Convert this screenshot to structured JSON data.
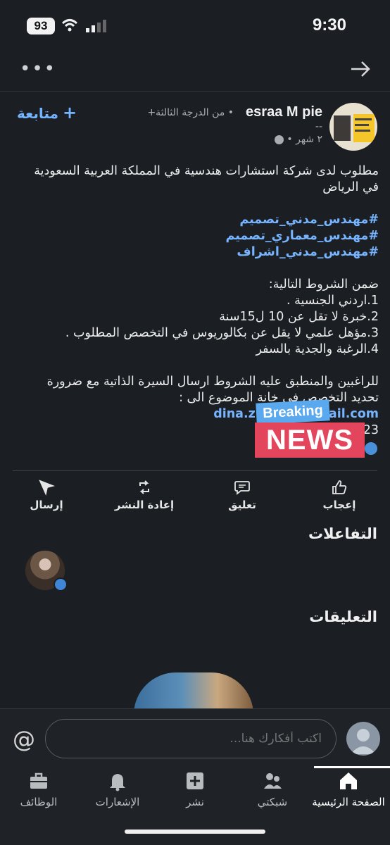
{
  "status": {
    "time": "9:30",
    "battery": "93"
  },
  "post": {
    "author_name": "esraa M pie",
    "degree": "• من الدرجة الثالثة+",
    "subtitle": "--",
    "time_ago": "٢ شهر •",
    "follow_label": "متابعة",
    "body": {
      "intro_1": "مطلوب لدى شركة استشارات هندسية في المملكة العربية السعودية",
      "intro_2": "في الرياض",
      "hashtags": [
        "#مهندس_مدني_تصميم",
        "#مهندس_معماري_تصميم",
        "#مهندس_مدني_اشراف"
      ],
      "conditions_title": "ضمن الشروط التالية:",
      "conditions": [
        "1.اردني الجنسية .",
        "2.خبرة لا تقل عن 10 ل15سنة",
        "3.مؤهل علمي لا يقل عن بكالوريوس في التخصص المطلوب .",
        "4.الرغبة والجدية بالسفر"
      ],
      "apply_1": "للراغبين والمنطبق عليه الشروط ارسال السيرة الذاتية مع ضرورة",
      "apply_2": "تحديد التخصص في خانة الموضوع الى :",
      "email_visible": "dina.z.i.085@gmail.com",
      "phone_visible": "222123"
    },
    "sticker": {
      "line1": "Breaking",
      "line2": "NEWS"
    }
  },
  "actions": {
    "like": "إعجاب",
    "comment": "تعليق",
    "repost": "إعادة النشر",
    "send": "إرسال"
  },
  "sections": {
    "reactions": "التفاعلات",
    "comments": "التعليقات"
  },
  "composer": {
    "placeholder": "اكتب أفكارك هنا..."
  },
  "bottom_nav": {
    "home": "الصفحة الرئيسية",
    "network": "شبكتي",
    "post": "نشر",
    "notifications": "الإشعارات",
    "jobs": "الوظائف"
  },
  "colors": {
    "accent": "#74b4ff",
    "background": "#1b1f23"
  }
}
